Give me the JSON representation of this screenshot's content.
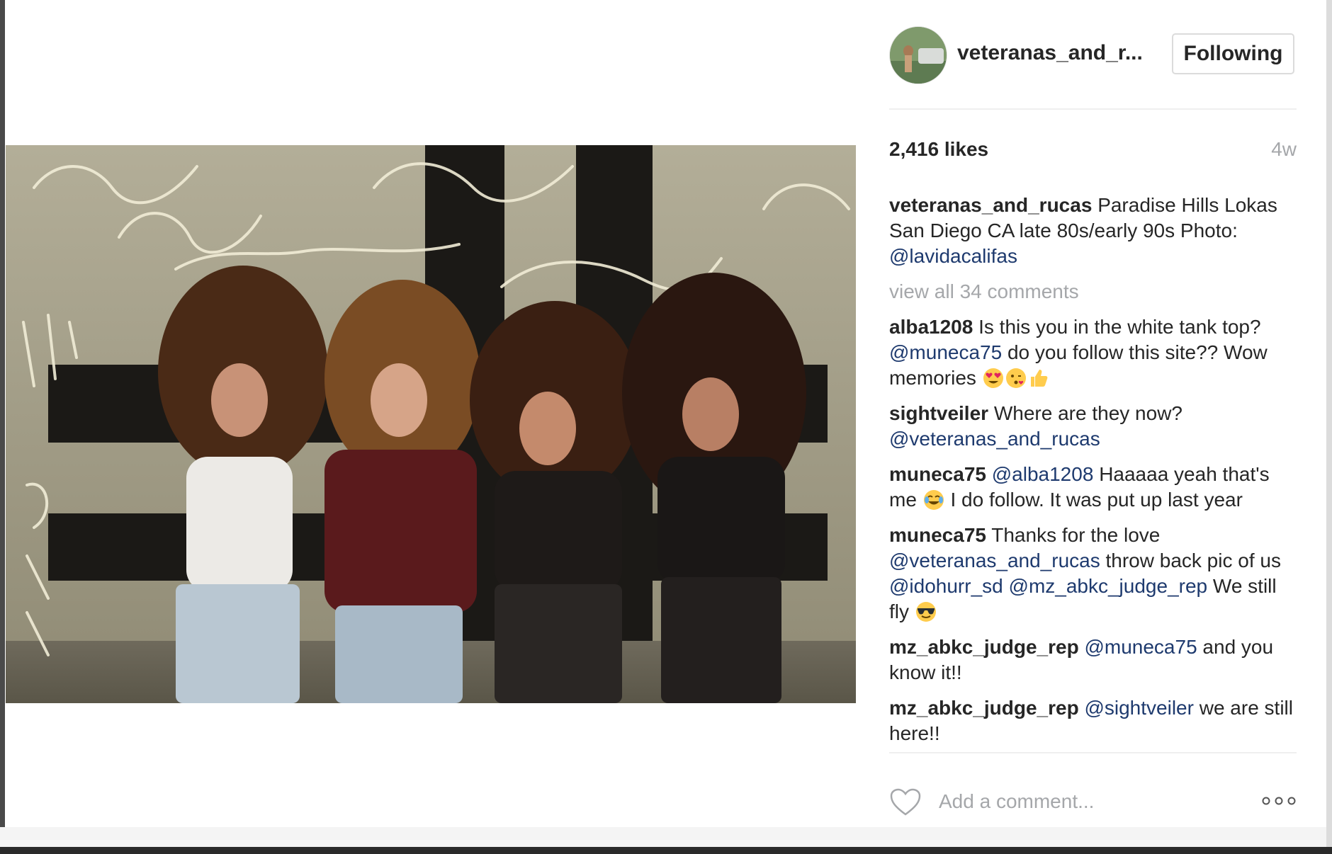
{
  "post": {
    "username": "veteranas_and_r...",
    "follow_label": "Following",
    "likes": "2,416 likes",
    "time_ago": "4w",
    "caption": {
      "author": "veteranas_and_rucas",
      "text": "Paradise Hills Lokas San Diego CA late 80s/early 90s Photo:",
      "mention": "@lavidacalifas"
    },
    "view_all": "view all 34 comments",
    "comments": [
      {
        "author": "alba1208",
        "text1": "Is this you in the white tank top?",
        "mention1": "@muneca75",
        "text2": "do you follow this site?? Wow memories",
        "emojis": [
          "heart-eyes-emoji",
          "kiss-emoji",
          "thumbs-up-emoji"
        ]
      },
      {
        "author": "sightveiler",
        "text1": "Where are they now?",
        "mention1": "@veteranas_and_rucas"
      },
      {
        "author": "muneca75",
        "mention1": "@alba1208",
        "text1": "Haaaaa yeah that's me",
        "emoji": "tears-of-joy-emoji",
        "text2": "I do follow. It was put up last year"
      },
      {
        "author": "muneca75",
        "text1": "Thanks for the love",
        "mention1": "@veteranas_and_rucas",
        "text2": "throw back pic of us",
        "mention2": "@idohurr_sd",
        "mention3": "@mz_abkc_judge_rep",
        "text3": "We still fly",
        "emoji": "sunglasses-emoji"
      },
      {
        "author": "mz_abkc_judge_rep",
        "mention1": "@muneca75",
        "text1": "and you know it!!"
      },
      {
        "author": "mz_abkc_judge_rep",
        "mention1": "@sightveiler",
        "text1": "we are still here!!"
      }
    ],
    "add_comment_placeholder": "Add a comment...",
    "icons": {
      "like": "heart-icon",
      "more": "more-options-icon"
    }
  },
  "colors": {
    "mention": "#1e3a6e",
    "muted": "#a5a7aa",
    "text": "#262626",
    "divider": "#efefef"
  }
}
